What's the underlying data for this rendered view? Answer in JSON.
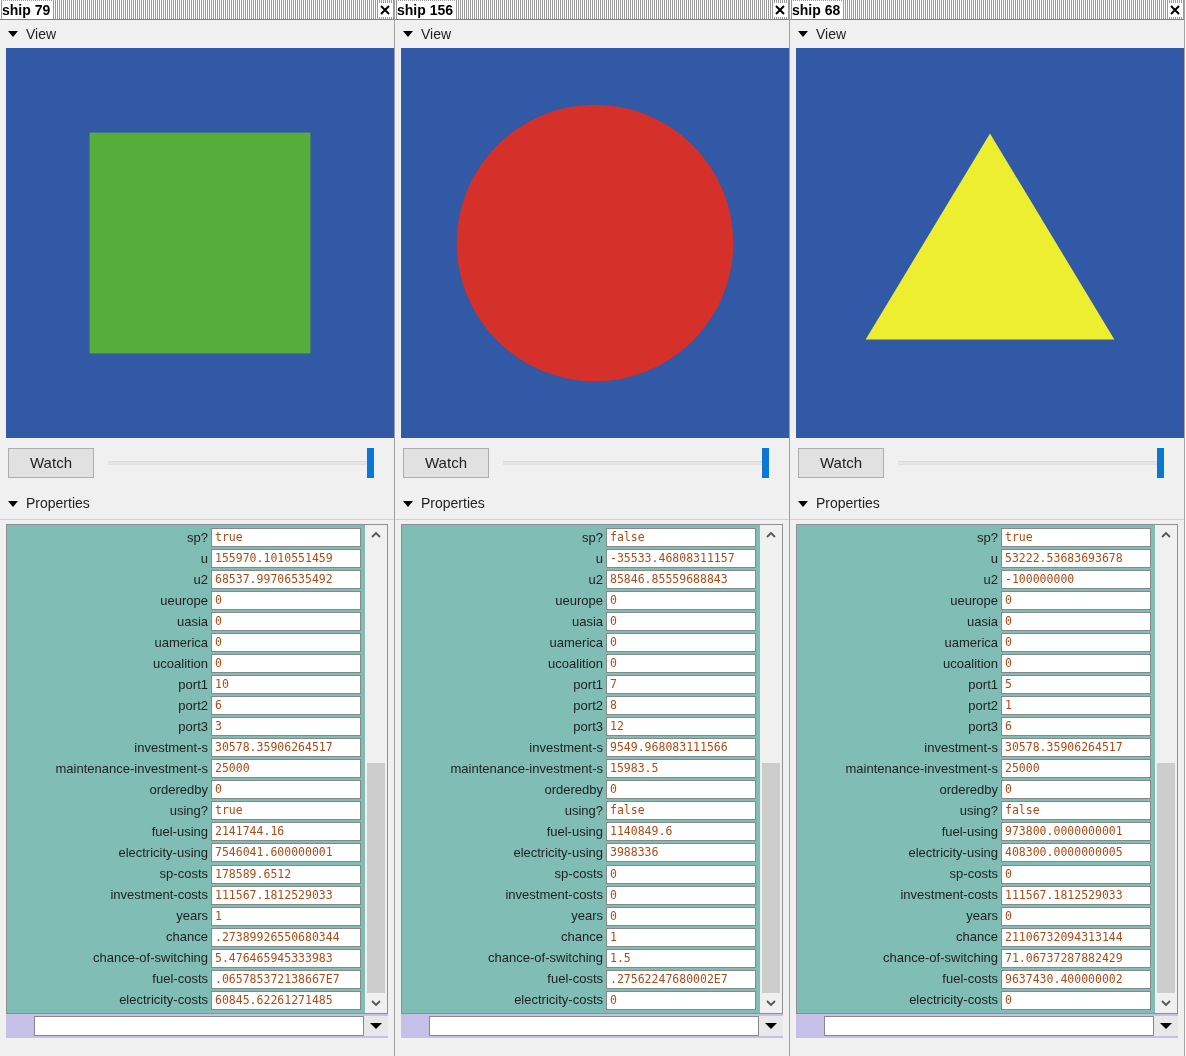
{
  "panels": [
    {
      "title": "ship 79",
      "view": {
        "label": "View",
        "expanded": true
      },
      "shape": {
        "kind": "square",
        "color": "#56ad3c"
      },
      "watch_button": "Watch",
      "slider": {
        "level": 1
      },
      "properties": {
        "label": "Properties",
        "expanded": true
      },
      "fields": [
        {
          "label": "sp?",
          "value": "true"
        },
        {
          "label": "u",
          "value": "155970.1010551459"
        },
        {
          "label": "u2",
          "value": "68537.99706535492"
        },
        {
          "label": "ueurope",
          "value": "0"
        },
        {
          "label": "uasia",
          "value": "0"
        },
        {
          "label": "uamerica",
          "value": "0"
        },
        {
          "label": "ucoalition",
          "value": "0"
        },
        {
          "label": "port1",
          "value": "10"
        },
        {
          "label": "port2",
          "value": "6"
        },
        {
          "label": "port3",
          "value": "3"
        },
        {
          "label": "investment-s",
          "value": "30578.35906264517"
        },
        {
          "label": "maintenance-investment-s",
          "value": "25000"
        },
        {
          "label": "orderedby",
          "value": "0"
        },
        {
          "label": "using?",
          "value": "true"
        },
        {
          "label": "fuel-using",
          "value": "2141744.16"
        },
        {
          "label": "electricity-using",
          "value": "7546041.600000001"
        },
        {
          "label": "sp-costs",
          "value": "178589.6512"
        },
        {
          "label": "investment-costs",
          "value": "111567.1812529033"
        },
        {
          "label": "years",
          "value": "1"
        },
        {
          "label": "chance",
          "value": ".27389926550680344"
        },
        {
          "label": "chance-of-switching",
          "value": "5.476465945333983"
        },
        {
          "label": "fuel-costs",
          "value": ".065785372138667E7"
        },
        {
          "label": "electricity-costs",
          "value": "60845.62261271485"
        }
      ]
    },
    {
      "title": "ship 156",
      "view": {
        "label": "View",
        "expanded": true
      },
      "shape": {
        "kind": "circle",
        "color": "#d5302a"
      },
      "watch_button": "Watch",
      "slider": {
        "level": 1
      },
      "properties": {
        "label": "Properties",
        "expanded": true
      },
      "fields": [
        {
          "label": "sp?",
          "value": "false"
        },
        {
          "label": "u",
          "value": "-35533.46808311157"
        },
        {
          "label": "u2",
          "value": "85846.85559688843"
        },
        {
          "label": "ueurope",
          "value": "0"
        },
        {
          "label": "uasia",
          "value": "0"
        },
        {
          "label": "uamerica",
          "value": "0"
        },
        {
          "label": "ucoalition",
          "value": "0"
        },
        {
          "label": "port1",
          "value": "7"
        },
        {
          "label": "port2",
          "value": "8"
        },
        {
          "label": "port3",
          "value": "12"
        },
        {
          "label": "investment-s",
          "value": "9549.968083111566"
        },
        {
          "label": "maintenance-investment-s",
          "value": "15983.5"
        },
        {
          "label": "orderedby",
          "value": "0"
        },
        {
          "label": "using?",
          "value": "false"
        },
        {
          "label": "fuel-using",
          "value": "1140849.6"
        },
        {
          "label": "electricity-using",
          "value": "3988336"
        },
        {
          "label": "sp-costs",
          "value": "0"
        },
        {
          "label": "investment-costs",
          "value": "0"
        },
        {
          "label": "years",
          "value": "0"
        },
        {
          "label": "chance",
          "value": "1"
        },
        {
          "label": "chance-of-switching",
          "value": "1.5"
        },
        {
          "label": "fuel-costs",
          "value": ".27562247680002E7"
        },
        {
          "label": "electricity-costs",
          "value": "0"
        }
      ]
    },
    {
      "title": "ship 68",
      "view": {
        "label": "View",
        "expanded": true
      },
      "shape": {
        "kind": "triangle",
        "color": "#eeee30"
      },
      "watch_button": "Watch",
      "slider": {
        "level": 1
      },
      "properties": {
        "label": "Properties",
        "expanded": true
      },
      "fields": [
        {
          "label": "sp?",
          "value": "true"
        },
        {
          "label": "u",
          "value": "53222.53683693678"
        },
        {
          "label": "u2",
          "value": "-100000000"
        },
        {
          "label": "ueurope",
          "value": "0"
        },
        {
          "label": "uasia",
          "value": "0"
        },
        {
          "label": "uamerica",
          "value": "0"
        },
        {
          "label": "ucoalition",
          "value": "0"
        },
        {
          "label": "port1",
          "value": "5"
        },
        {
          "label": "port2",
          "value": "1"
        },
        {
          "label": "port3",
          "value": "6"
        },
        {
          "label": "investment-s",
          "value": "30578.35906264517"
        },
        {
          "label": "maintenance-investment-s",
          "value": "25000"
        },
        {
          "label": "orderedby",
          "value": "0"
        },
        {
          "label": "using?",
          "value": "false"
        },
        {
          "label": "fuel-using",
          "value": "973800.0000000001"
        },
        {
          "label": "electricity-using",
          "value": "408300.0000000005"
        },
        {
          "label": "sp-costs",
          "value": "0"
        },
        {
          "label": "investment-costs",
          "value": "111567.1812529033"
        },
        {
          "label": "years",
          "value": "0"
        },
        {
          "label": "chance",
          "value": "21106732094313144"
        },
        {
          "label": "chance-of-switching",
          "value": "71.06737287882429"
        },
        {
          "label": "fuel-costs",
          "value": "9637430.400000002"
        },
        {
          "label": "electricity-costs",
          "value": "0"
        }
      ]
    }
  ]
}
